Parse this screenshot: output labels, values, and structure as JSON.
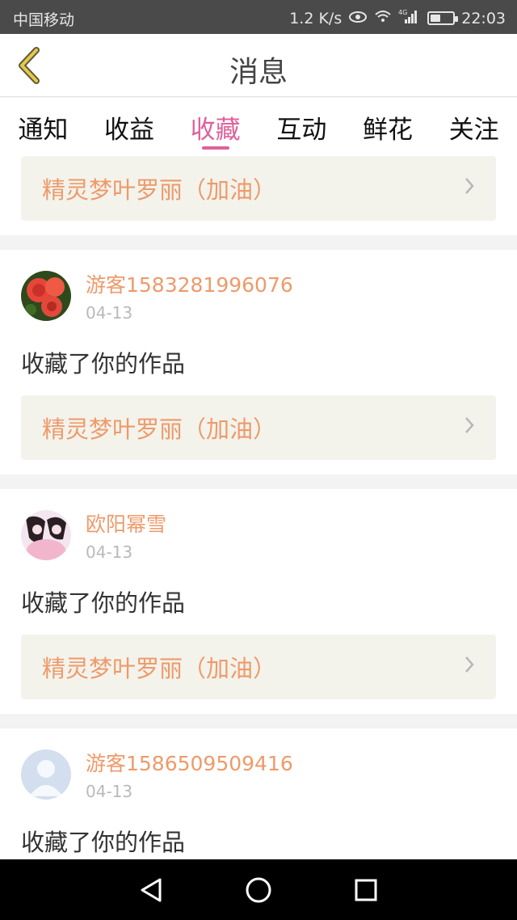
{
  "status_bar": {
    "carrier": "中国移动",
    "speed": "1.2 K/s",
    "network": "4G",
    "time": "22:03",
    "battery_level": 0.45
  },
  "header": {
    "title": "消息"
  },
  "tabs": [
    {
      "label": "通知",
      "active": false
    },
    {
      "label": "收益",
      "active": false
    },
    {
      "label": "收藏",
      "active": true
    },
    {
      "label": "互动",
      "active": false
    },
    {
      "label": "鲜花",
      "active": false
    },
    {
      "label": "关注",
      "active": false
    }
  ],
  "feed": {
    "partial_card": {
      "work_title": "精灵梦叶罗丽（加油）"
    },
    "items": [
      {
        "username": "游客1583281996076",
        "date": "04-13",
        "action": "收藏了你的作品",
        "work_title": "精灵梦叶罗丽（加油）",
        "avatar": "rose-avatar"
      },
      {
        "username": "欧阳幂雪",
        "date": "04-13",
        "action": "收藏了你的作品",
        "work_title": "精灵梦叶罗丽（加油）",
        "avatar": "girl-avatar"
      },
      {
        "username": "游客1586509509416",
        "date": "04-13",
        "action": "收藏了你的作品",
        "work_title": "",
        "avatar": "default-avatar"
      }
    ]
  },
  "colors": {
    "accent": "#e0609b",
    "name": "#ee9a6a",
    "back_arrow": "#e8c84a"
  }
}
